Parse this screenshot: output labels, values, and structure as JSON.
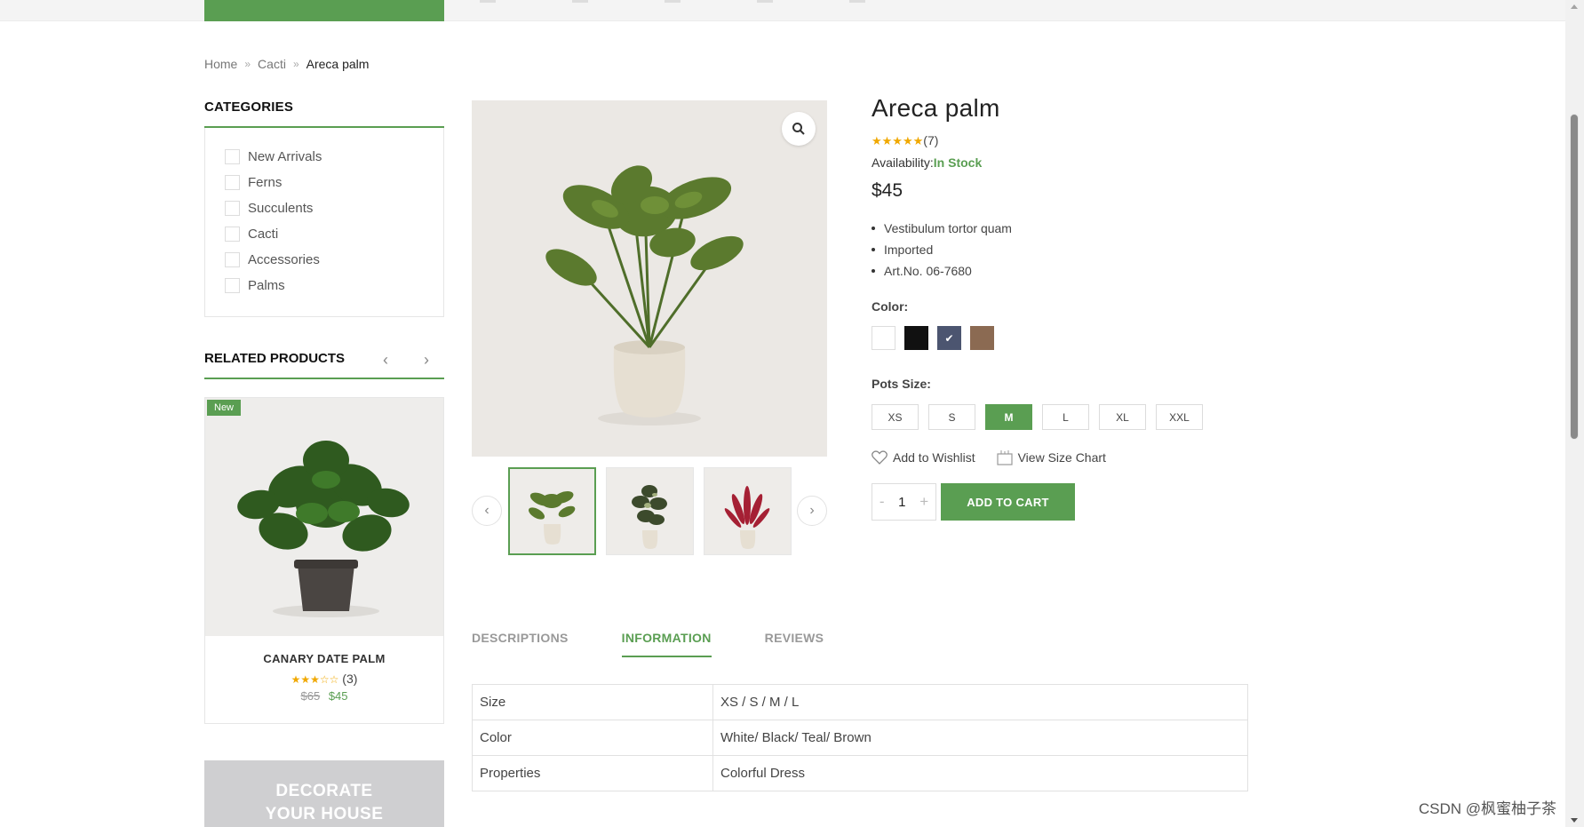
{
  "breadcrumb": {
    "home": "Home",
    "parent": "Cacti",
    "current": "Areca palm"
  },
  "sidebar": {
    "categories_title": "CATEGORIES",
    "categories": [
      {
        "label": "New Arrivals"
      },
      {
        "label": "Ferns"
      },
      {
        "label": "Succulents"
      },
      {
        "label": "Cacti"
      },
      {
        "label": "Accessories"
      },
      {
        "label": "Palms"
      }
    ],
    "related_title": "RELATED PRODUCTS",
    "related_product": {
      "badge": "New",
      "name": "CANARY DATE PALM",
      "stars": "★★★☆☆",
      "review_count": "(3)",
      "old_price": "$65",
      "new_price": "$45"
    },
    "banner_line1": "DECORATE",
    "banner_line2": "YOUR HOUSE"
  },
  "product": {
    "title": "Areca palm",
    "stars": "★★★★★",
    "review_count": "(7)",
    "availability_label": "Availability:",
    "availability_value": "In Stock",
    "price": "$45",
    "bullets": [
      "Vestibulum tortor quam",
      "Imported",
      "Art.No. 06-7680"
    ],
    "color_label": "Color:",
    "colors": [
      {
        "name": "white",
        "hex": "#ffffff",
        "selected": false
      },
      {
        "name": "black",
        "hex": "#111111",
        "selected": false
      },
      {
        "name": "slate",
        "hex": "#4c5570",
        "selected": true
      },
      {
        "name": "brown",
        "hex": "#8b6a52",
        "selected": false
      }
    ],
    "size_label": "Pots Size:",
    "sizes": [
      {
        "label": "XS",
        "selected": false
      },
      {
        "label": "S",
        "selected": false
      },
      {
        "label": "M",
        "selected": true
      },
      {
        "label": "L",
        "selected": false
      },
      {
        "label": "XL",
        "selected": false
      },
      {
        "label": "XXL",
        "selected": false
      }
    ],
    "wishlist_label": "Add to Wishlist",
    "size_chart_label": "View Size Chart",
    "quantity": "1",
    "qty_minus": "-",
    "qty_plus": "+",
    "add_to_cart_label": "ADD TO CART"
  },
  "tabs": [
    {
      "label": "DESCRIPTIONS",
      "active": false
    },
    {
      "label": "INFORMATION",
      "active": true
    },
    {
      "label": "REVIEWS",
      "active": false
    }
  ],
  "info_table": [
    {
      "key": "Size",
      "value": "XS / S / M / L"
    },
    {
      "key": "Color",
      "value": "White/ Black/ Teal/ Brown"
    },
    {
      "key": "Properties",
      "value": "Colorful Dress"
    }
  ],
  "watermark": "CSDN @枫蜜柚子茶",
  "colors": {
    "accent": "#5a9e52",
    "star": "#f0a800"
  }
}
